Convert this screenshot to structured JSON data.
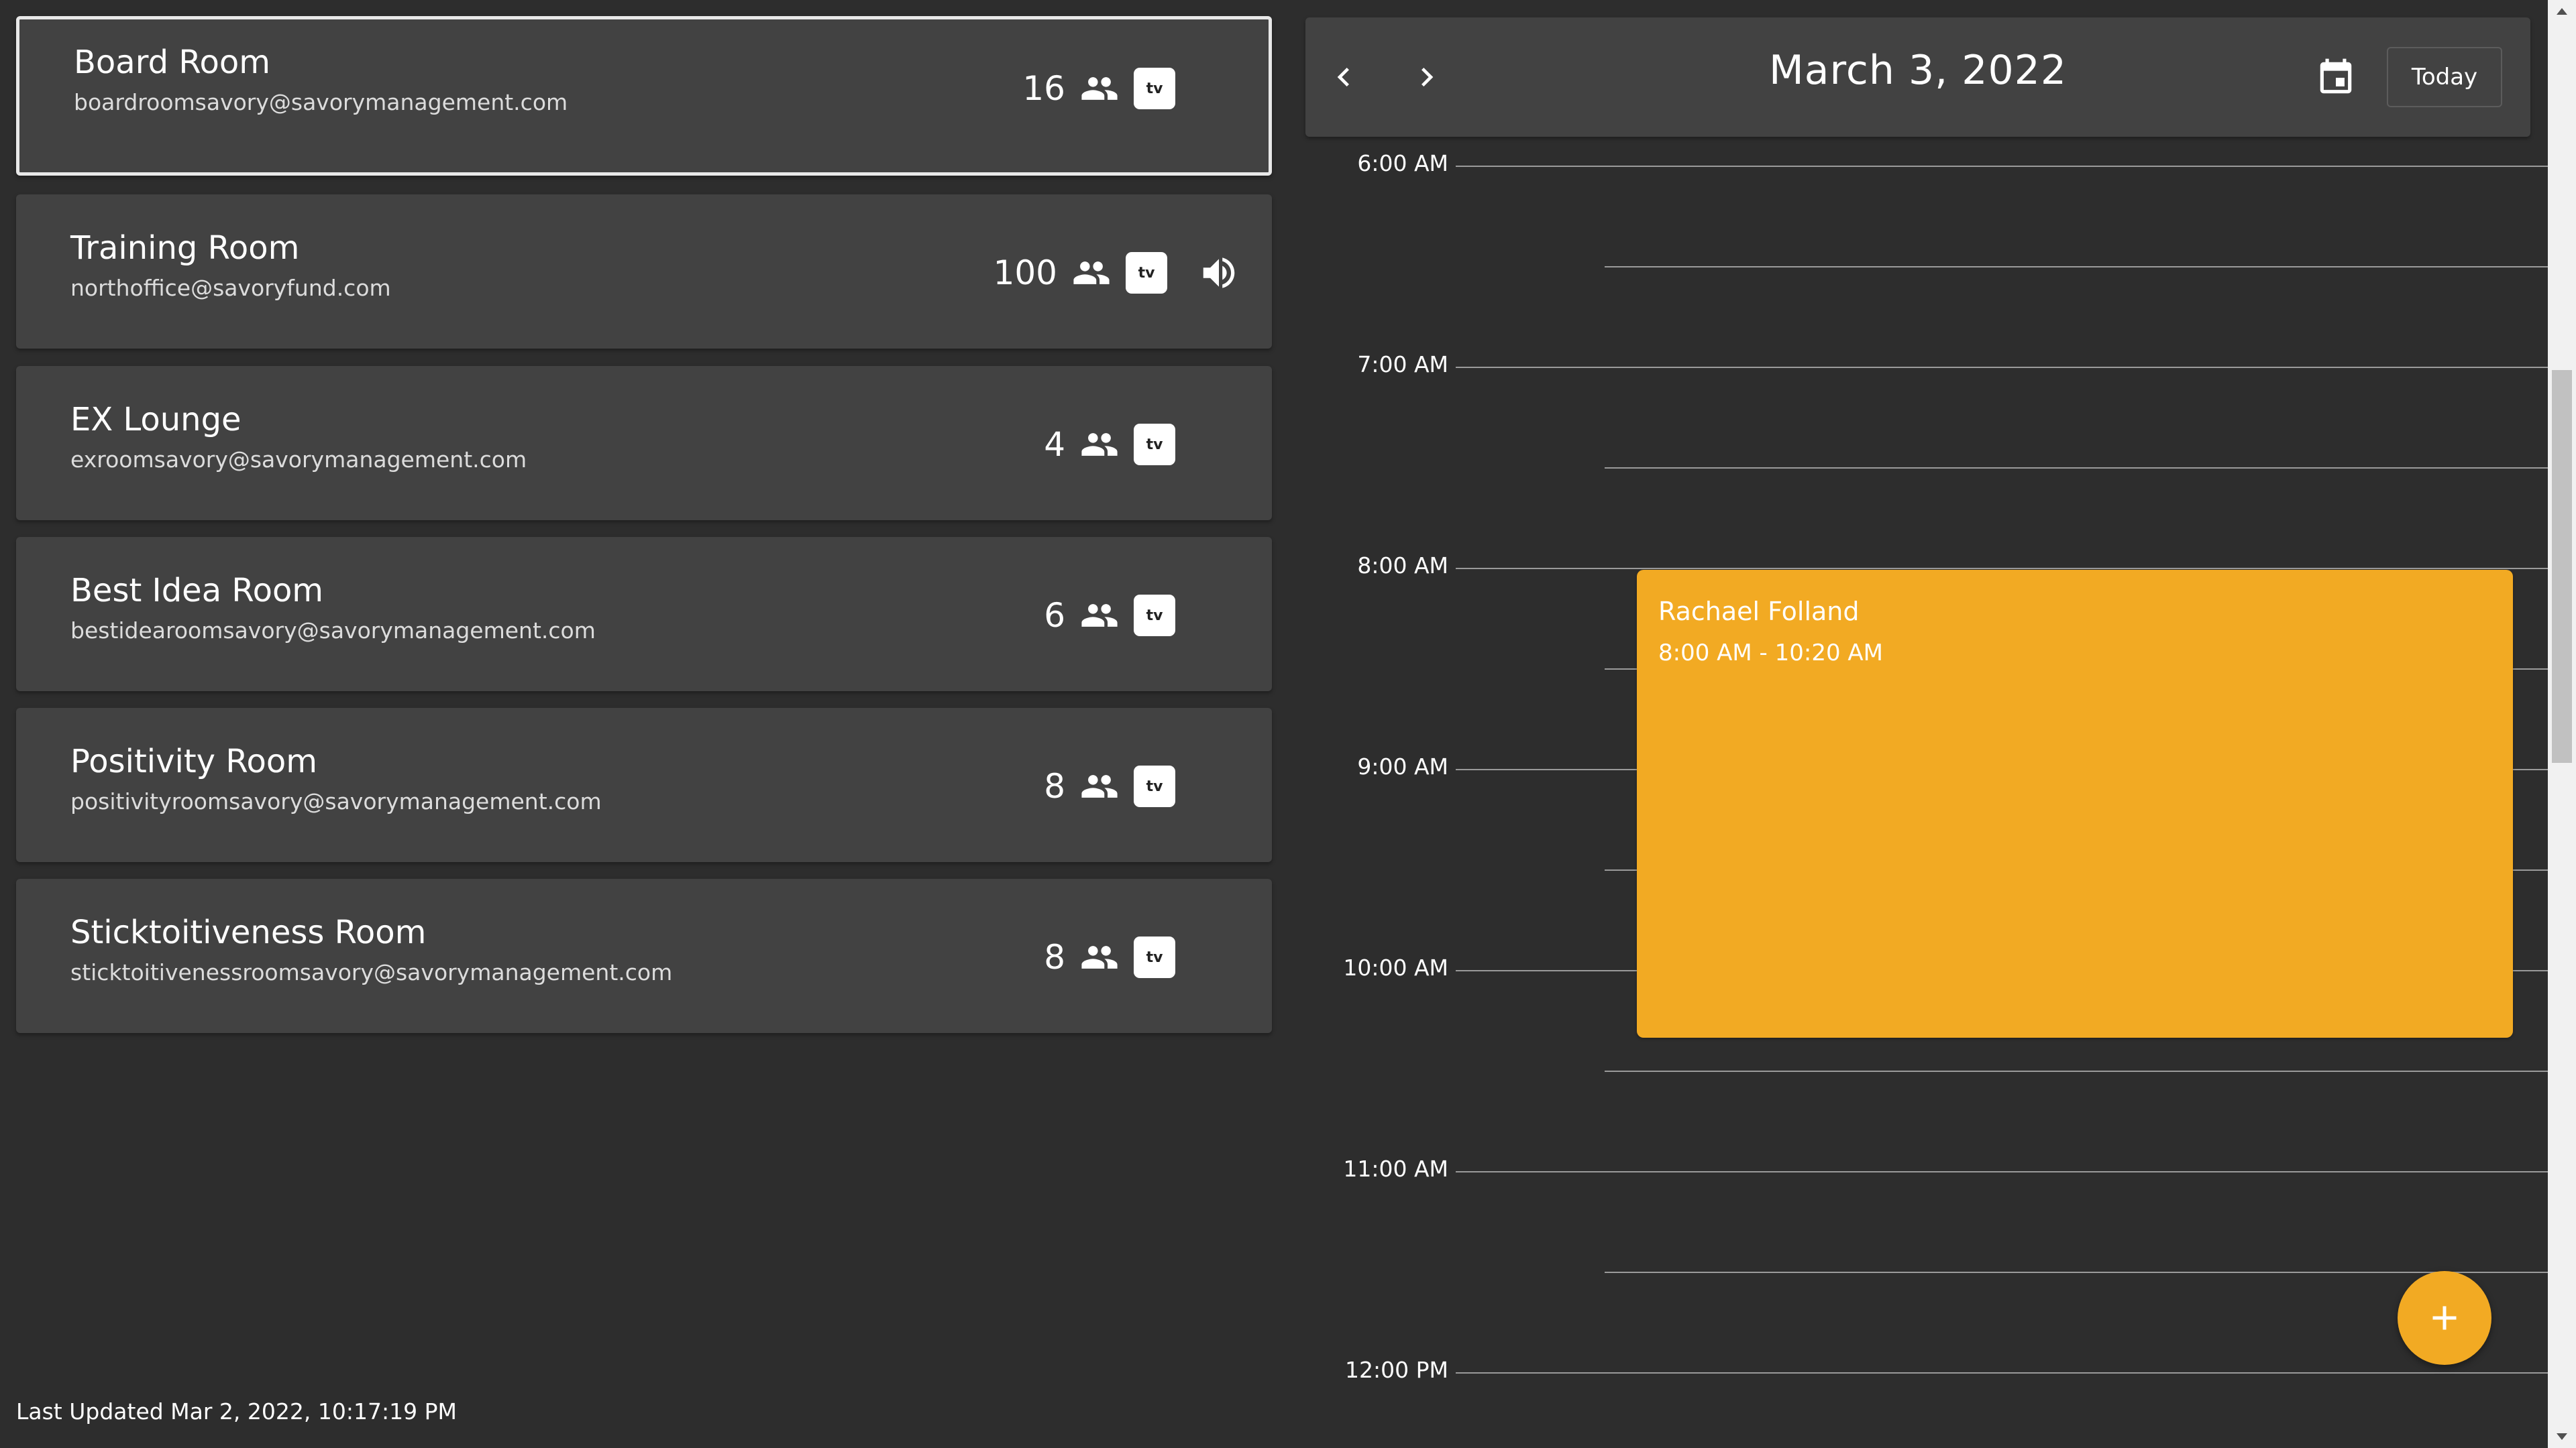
{
  "rooms": [
    {
      "name": "Board Room",
      "email": "boardroomsavory@savorymanagement.com",
      "capacity": "16",
      "selected": true,
      "has_tv": true,
      "has_audio": false
    },
    {
      "name": "Training Room",
      "email": "northoffice@savoryfund.com",
      "capacity": "100",
      "selected": false,
      "has_tv": true,
      "has_audio": true
    },
    {
      "name": "EX Lounge",
      "email": "exroomsavory@savorymanagement.com",
      "capacity": "4",
      "selected": false,
      "has_tv": true,
      "has_audio": false
    },
    {
      "name": "Best Idea Room",
      "email": "bestidearoomsavory@savorymanagement.com",
      "capacity": "6",
      "selected": false,
      "has_tv": true,
      "has_audio": false
    },
    {
      "name": "Positivity Room",
      "email": "positivityroomsavory@savorymanagement.com",
      "capacity": "8",
      "selected": false,
      "has_tv": true,
      "has_audio": false
    },
    {
      "name": "Sticktoitiveness Room",
      "email": "sticktoitivenessroomsavory@savorymanagement.com",
      "capacity": "8",
      "selected": false,
      "has_tv": true,
      "has_audio": false
    }
  ],
  "tv_icon_text": "tv",
  "last_updated": "Last Updated Mar 2, 2022, 10:17:19 PM",
  "calendar": {
    "date": "March 3, 2022",
    "today_label": "Today",
    "hours": [
      "6:00 AM",
      "7:00 AM",
      "8:00 AM",
      "9:00 AM",
      "10:00 AM",
      "11:00 AM",
      "12:00 PM"
    ],
    "events": [
      {
        "title": "Rachael Folland",
        "time": "8:00 AM - 10:20 AM"
      }
    ]
  },
  "colors": {
    "background": "#2d2d2d",
    "card": "#424242",
    "accent": "#f2aa23"
  },
  "icons": {
    "people": "people-icon",
    "tv": "apple-tv-icon",
    "audio": "speaker-icon",
    "prev": "chevron-left-icon",
    "next": "chevron-right-icon",
    "calendar": "calendar-icon",
    "add": "plus-icon"
  }
}
